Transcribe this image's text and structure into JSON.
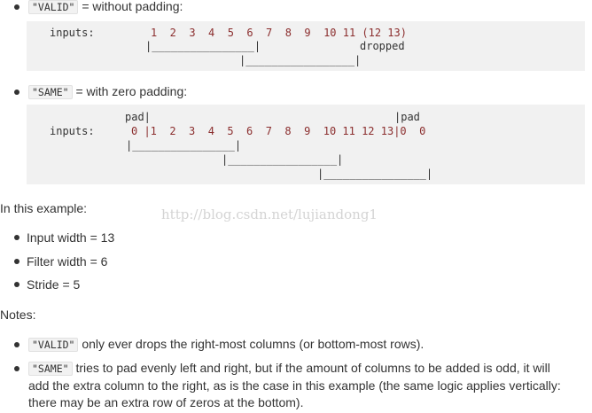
{
  "valid_item": {
    "code": "\"VALID\"",
    "text": "= without padding:"
  },
  "valid_block": {
    "label": "inputs:",
    "numbers": "1  2  3  4  5  6  7  8  9  10 11 (12 13)",
    "window1": "|________________|",
    "dropped": "dropped",
    "window2": "|_________________|"
  },
  "same_item": {
    "code": "\"SAME\"",
    "text": "= with zero padding:"
  },
  "same_block": {
    "pad_left": "pad|",
    "pad_right": "|pad",
    "label": "inputs:",
    "numbers": "0 |1  2  3  4  5  6  7  8  9  10 11 12 13|0  0",
    "window1": "|________________|",
    "window2": "|_________________|",
    "window3": "|________________|"
  },
  "example_heading": "In this example:",
  "example_items": [
    "Input width = 13",
    "Filter width = 6",
    "Stride = 5"
  ],
  "notes_heading": "Notes:",
  "notes": [
    {
      "code": "\"VALID\"",
      "text": "only ever drops the right-most columns (or bottom-most rows)."
    },
    {
      "code": "\"SAME\"",
      "line1": "tries to pad evenly left and right, but if the amount of columns to be added is odd, it will",
      "line2": "add the extra column to the right, as is the case in this example (the same logic applies vertically:",
      "line3": "there may be an extra row of zeros at the bottom)."
    }
  ],
  "watermark": "http://blog.csdn.net/lujiandong1"
}
